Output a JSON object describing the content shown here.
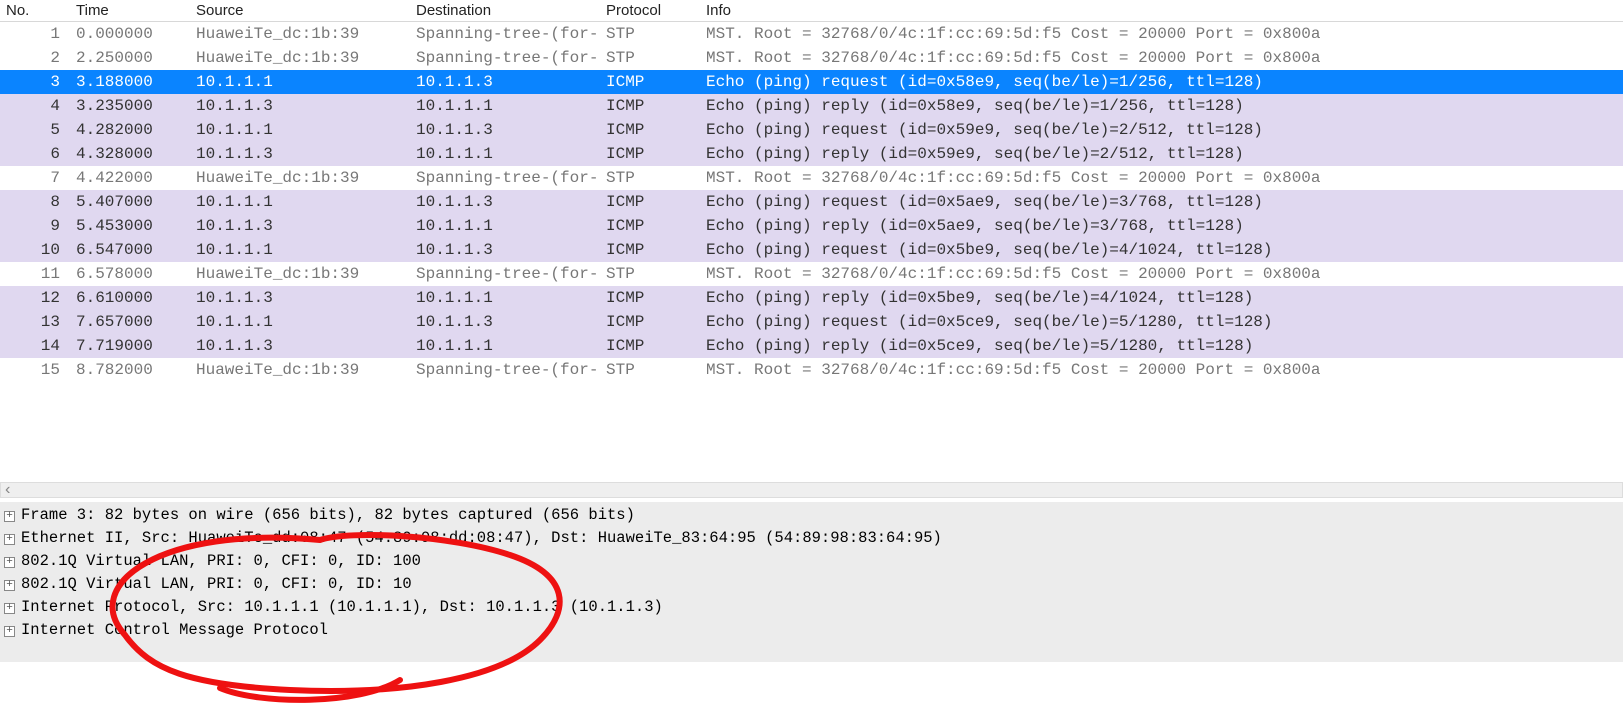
{
  "columns": {
    "no": "No.",
    "time": "Time",
    "source": "Source",
    "destination": "Destination",
    "protocol": "Protocol",
    "info": "Info"
  },
  "packets": [
    {
      "no": "1",
      "time": "0.000000",
      "src": "HuaweiTe_dc:1b:39",
      "dst": "Spanning-tree-(for-",
      "proto": "STP",
      "info": "MST. Root = 32768/0/4c:1f:cc:69:5d:f5  Cost = 20000   Port = 0x800a",
      "cls": "row-stp"
    },
    {
      "no": "2",
      "time": "2.250000",
      "src": "HuaweiTe_dc:1b:39",
      "dst": "Spanning-tree-(for-",
      "proto": "STP",
      "info": "MST. Root = 32768/0/4c:1f:cc:69:5d:f5  Cost = 20000   Port = 0x800a",
      "cls": "row-stp"
    },
    {
      "no": "3",
      "time": "3.188000",
      "src": "10.1.1.1",
      "dst": "10.1.1.3",
      "proto": "ICMP",
      "info": "Echo (ping) request  (id=0x58e9, seq(be/le)=1/256, ttl=128)",
      "cls": "row-sel"
    },
    {
      "no": "4",
      "time": "3.235000",
      "src": "10.1.1.3",
      "dst": "10.1.1.1",
      "proto": "ICMP",
      "info": "Echo (ping) reply    (id=0x58e9, seq(be/le)=1/256, ttl=128)",
      "cls": "row-icmp"
    },
    {
      "no": "5",
      "time": "4.282000",
      "src": "10.1.1.1",
      "dst": "10.1.1.3",
      "proto": "ICMP",
      "info": "Echo (ping) request  (id=0x59e9, seq(be/le)=2/512, ttl=128)",
      "cls": "row-icmp"
    },
    {
      "no": "6",
      "time": "4.328000",
      "src": "10.1.1.3",
      "dst": "10.1.1.1",
      "proto": "ICMP",
      "info": "Echo (ping) reply    (id=0x59e9, seq(be/le)=2/512, ttl=128)",
      "cls": "row-icmp"
    },
    {
      "no": "7",
      "time": "4.422000",
      "src": "HuaweiTe_dc:1b:39",
      "dst": "Spanning-tree-(for-",
      "proto": "STP",
      "info": "MST. Root = 32768/0/4c:1f:cc:69:5d:f5  Cost = 20000   Port = 0x800a",
      "cls": "row-stp"
    },
    {
      "no": "8",
      "time": "5.407000",
      "src": "10.1.1.1",
      "dst": "10.1.1.3",
      "proto": "ICMP",
      "info": "Echo (ping) request  (id=0x5ae9, seq(be/le)=3/768, ttl=128)",
      "cls": "row-icmp"
    },
    {
      "no": "9",
      "time": "5.453000",
      "src": "10.1.1.3",
      "dst": "10.1.1.1",
      "proto": "ICMP",
      "info": "Echo (ping) reply    (id=0x5ae9, seq(be/le)=3/768, ttl=128)",
      "cls": "row-icmp"
    },
    {
      "no": "10",
      "time": "6.547000",
      "src": "10.1.1.1",
      "dst": "10.1.1.3",
      "proto": "ICMP",
      "info": "Echo (ping) request  (id=0x5be9, seq(be/le)=4/1024, ttl=128)",
      "cls": "row-icmp"
    },
    {
      "no": "11",
      "time": "6.578000",
      "src": "HuaweiTe_dc:1b:39",
      "dst": "Spanning-tree-(for-",
      "proto": "STP",
      "info": "MST. Root = 32768/0/4c:1f:cc:69:5d:f5  Cost = 20000   Port = 0x800a",
      "cls": "row-stp"
    },
    {
      "no": "12",
      "time": "6.610000",
      "src": "10.1.1.3",
      "dst": "10.1.1.1",
      "proto": "ICMP",
      "info": "Echo (ping) reply    (id=0x5be9, seq(be/le)=4/1024, ttl=128)",
      "cls": "row-icmp"
    },
    {
      "no": "13",
      "time": "7.657000",
      "src": "10.1.1.1",
      "dst": "10.1.1.3",
      "proto": "ICMP",
      "info": "Echo (ping) request  (id=0x5ce9, seq(be/le)=5/1280, ttl=128)",
      "cls": "row-icmp"
    },
    {
      "no": "14",
      "time": "7.719000",
      "src": "10.1.1.3",
      "dst": "10.1.1.1",
      "proto": "ICMP",
      "info": "Echo (ping) reply    (id=0x5ce9, seq(be/le)=5/1280, ttl=128)",
      "cls": "row-icmp"
    },
    {
      "no": "15",
      "time": "8.782000",
      "src": "HuaweiTe_dc:1b:39",
      "dst": "Spanning-tree-(for-",
      "proto": "STP",
      "info": "MST. Root = 32768/0/4c:1f:cc:69:5d:f5  Cost = 20000   Port = 0x800a",
      "cls": "row-stp"
    }
  ],
  "details": {
    "frame": "Frame 3: 82 bytes on wire (656 bits), 82 bytes captured (656 bits)",
    "eth": "Ethernet II, Src: HuaweiTe_dd:08:47 (54:89:98:dd:08:47), Dst: HuaweiTe_83:64:95 (54:89:98:83:64:95)",
    "vlan1": "802.1Q Virtual LAN, PRI: 0, CFI: 0, ID: 100",
    "vlan2": "802.1Q Virtual LAN, PRI: 0, CFI: 0, ID: 10",
    "ip": "Internet Protocol, Src: 10.1.1.1 (10.1.1.1), Dst: 10.1.1.3 (10.1.1.3)",
    "icmp": "Internet Control Message Protocol"
  },
  "expander_glyph": "+"
}
